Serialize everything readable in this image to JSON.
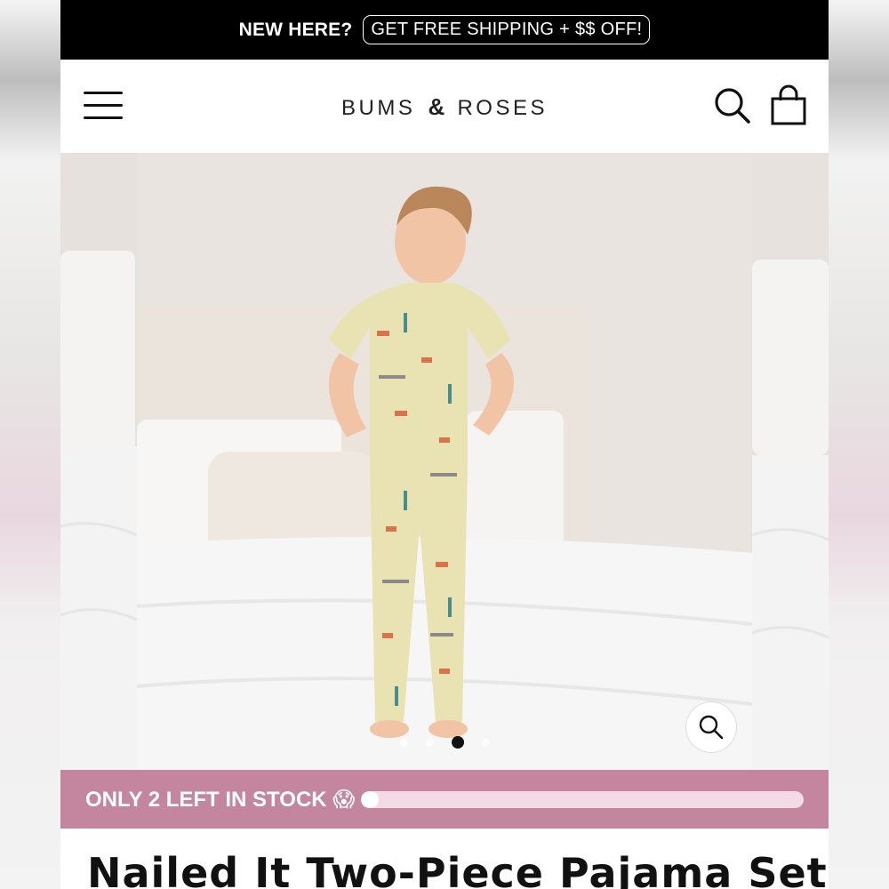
{
  "announcement": {
    "lead": "NEW HERE?",
    "offer": "GET FREE SHIPPING + $$ OFF!"
  },
  "header": {
    "logo_left": "BUMS",
    "logo_amp": "&",
    "logo_right": "ROSES",
    "menu_icon": "hamburger-icon",
    "search_icon": "search-icon",
    "cart_icon": "shopping-bag-icon"
  },
  "gallery": {
    "slide_count": 4,
    "active_slide": 3,
    "zoom_icon": "zoom-icon"
  },
  "stock": {
    "text": "ONLY 2 LEFT IN STOCK",
    "emoji": "😱",
    "progress_fraction": 0.04
  },
  "product": {
    "title": "Nailed It Two-Piece Pajama Set -"
  },
  "colors": {
    "announcement_bg": "#000000",
    "stock_bg": "#c4869f",
    "progress_track": "#f3dbe5"
  }
}
